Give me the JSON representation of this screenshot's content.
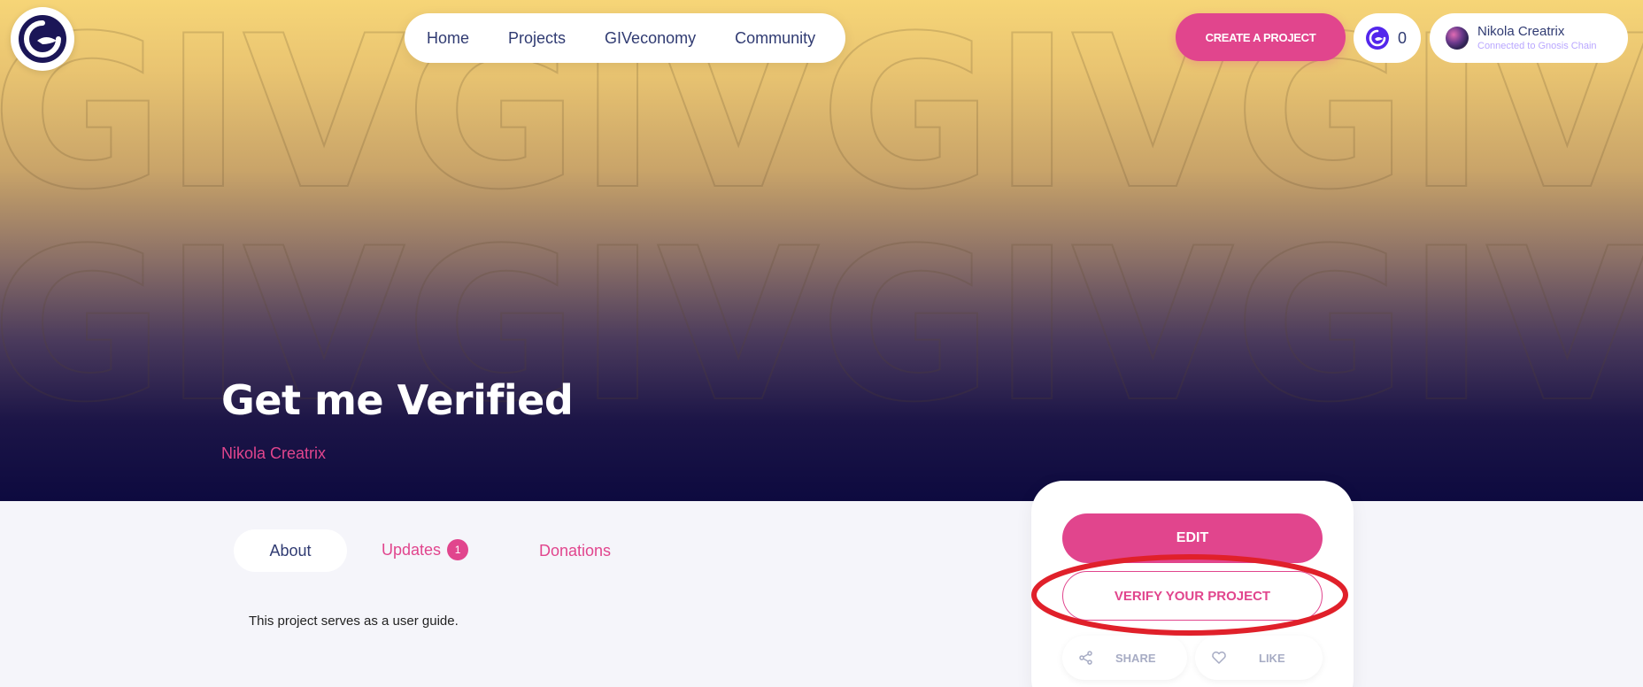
{
  "hero": {
    "pattern_text": "GIVGIVGIVGIVGIV"
  },
  "nav": {
    "links": [
      {
        "label": "Home"
      },
      {
        "label": "Projects"
      },
      {
        "label": "GIVeconomy"
      },
      {
        "label": "Community"
      }
    ]
  },
  "header": {
    "create_label": "CREATE A PROJECT",
    "giv_count": "0",
    "user_name": "Nikola Creatrix",
    "user_chain": "Connected to Gnosis Chain"
  },
  "project": {
    "title": "Get me Verified",
    "author": "Nikola Creatrix",
    "description": "This project serves as a user guide."
  },
  "tabs": {
    "about": "About",
    "updates": "Updates",
    "updates_badge": "1",
    "donations": "Donations"
  },
  "actions": {
    "edit": "EDIT",
    "verify": "VERIFY YOUR PROJECT",
    "share": "SHARE",
    "like": "LIKE"
  },
  "colors": {
    "accent": "#e1458d",
    "navy": "#303b72",
    "annotation": "#e0202a"
  }
}
